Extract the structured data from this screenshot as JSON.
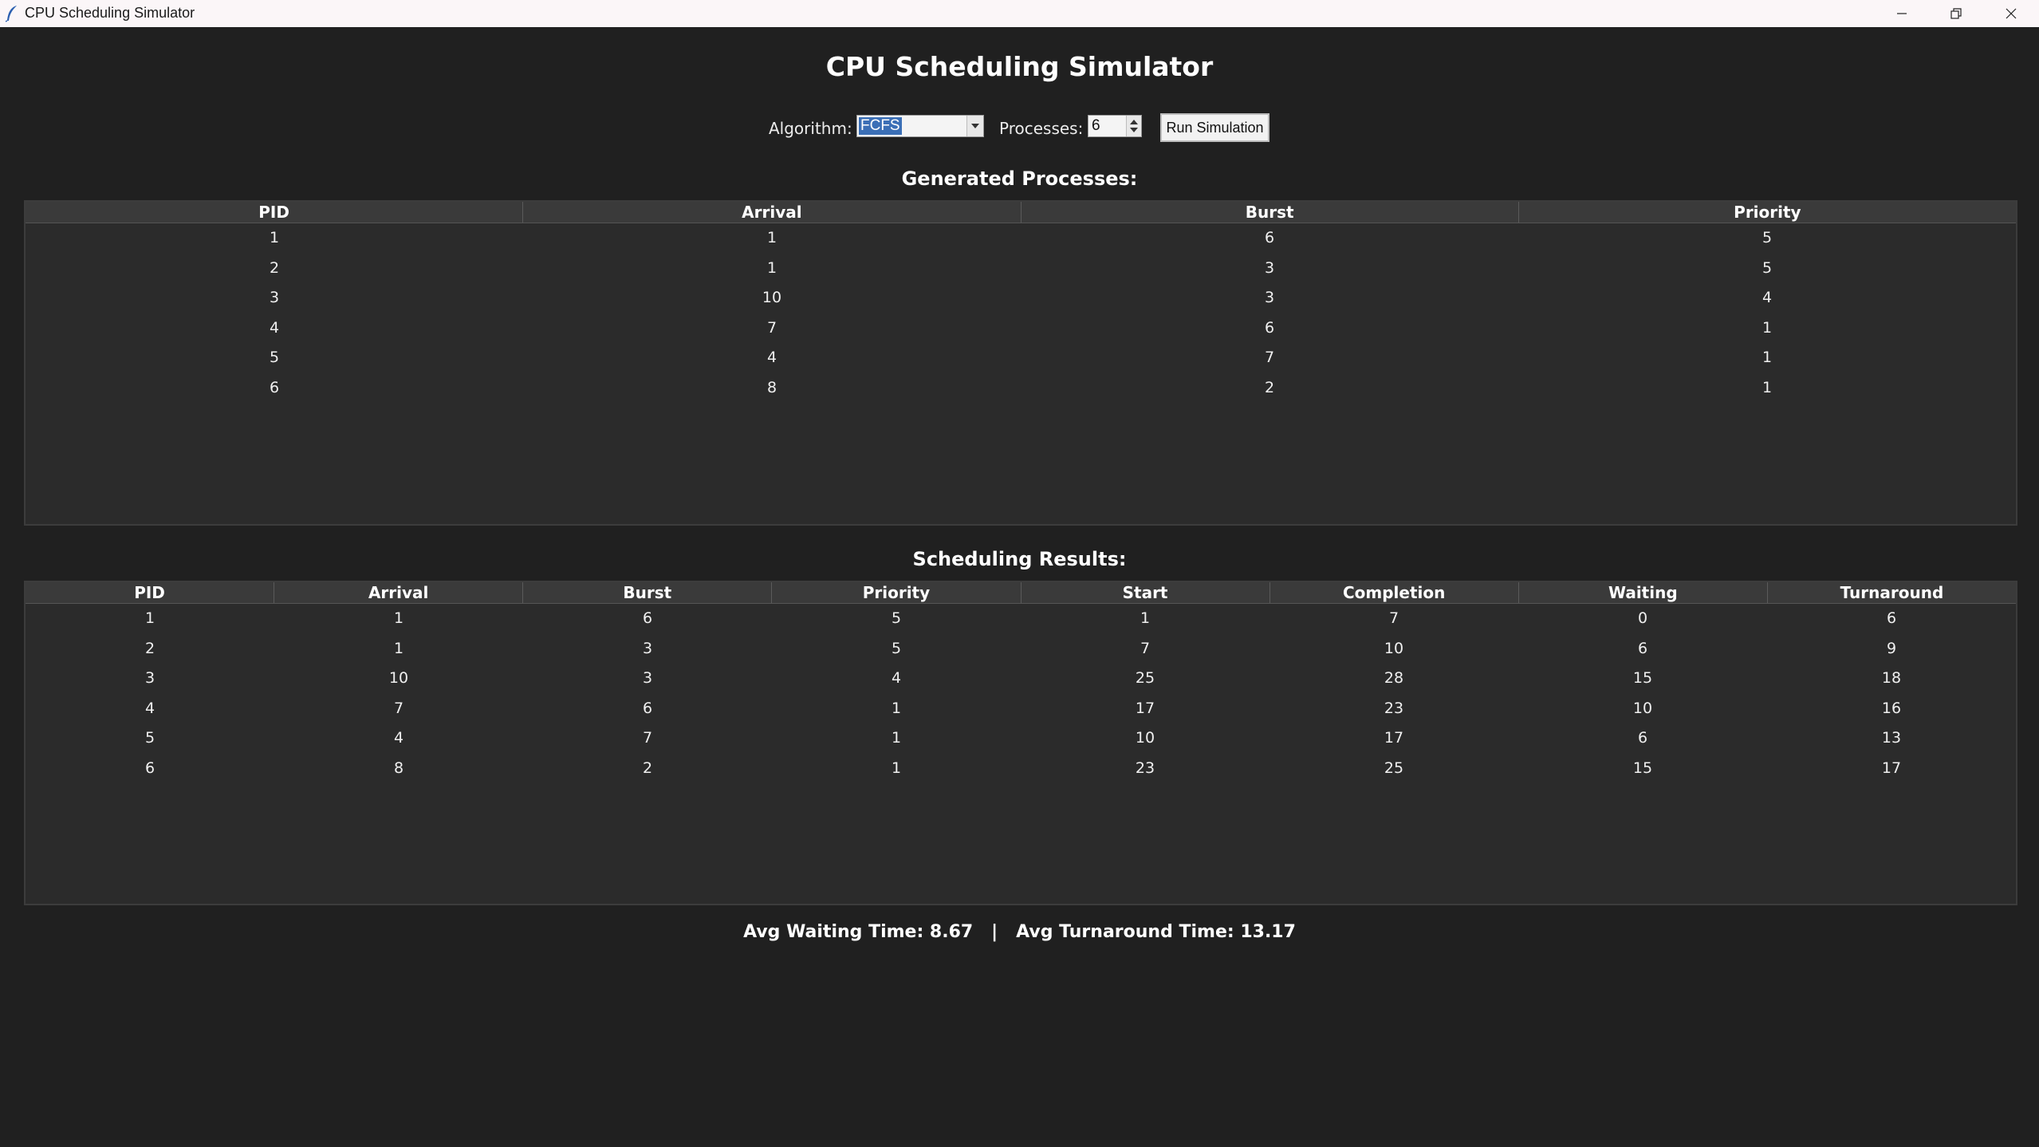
{
  "window": {
    "title": "CPU Scheduling Simulator"
  },
  "header": {
    "title": "CPU Scheduling Simulator"
  },
  "controls": {
    "algorithm_label": "Algorithm:",
    "algorithm_value": "FCFS",
    "processes_label": "Processes:",
    "processes_value": "6",
    "run_label": "Run Simulation"
  },
  "generated": {
    "title": "Generated Processes:",
    "columns": [
      "PID",
      "Arrival",
      "Burst",
      "Priority"
    ],
    "rows": [
      [
        "1",
        "1",
        "6",
        "5"
      ],
      [
        "2",
        "1",
        "3",
        "5"
      ],
      [
        "3",
        "10",
        "3",
        "4"
      ],
      [
        "4",
        "7",
        "6",
        "1"
      ],
      [
        "5",
        "4",
        "7",
        "1"
      ],
      [
        "6",
        "8",
        "2",
        "1"
      ]
    ]
  },
  "results": {
    "title": "Scheduling Results:",
    "columns": [
      "PID",
      "Arrival",
      "Burst",
      "Priority",
      "Start",
      "Completion",
      "Waiting",
      "Turnaround"
    ],
    "rows": [
      [
        "1",
        "1",
        "6",
        "5",
        "1",
        "7",
        "0",
        "6"
      ],
      [
        "2",
        "1",
        "3",
        "5",
        "7",
        "10",
        "6",
        "9"
      ],
      [
        "3",
        "10",
        "3",
        "4",
        "25",
        "28",
        "15",
        "18"
      ],
      [
        "4",
        "7",
        "6",
        "1",
        "17",
        "23",
        "10",
        "16"
      ],
      [
        "5",
        "4",
        "7",
        "1",
        "10",
        "17",
        "6",
        "13"
      ],
      [
        "6",
        "8",
        "2",
        "1",
        "23",
        "25",
        "15",
        "17"
      ]
    ]
  },
  "summary": {
    "text": "Avg Waiting Time: 8.67   |   Avg Turnaround Time: 13.17"
  },
  "icons": {
    "app": "feather-icon",
    "minimize": "minimize-icon",
    "maximize": "restore-icon",
    "close": "close-icon"
  }
}
